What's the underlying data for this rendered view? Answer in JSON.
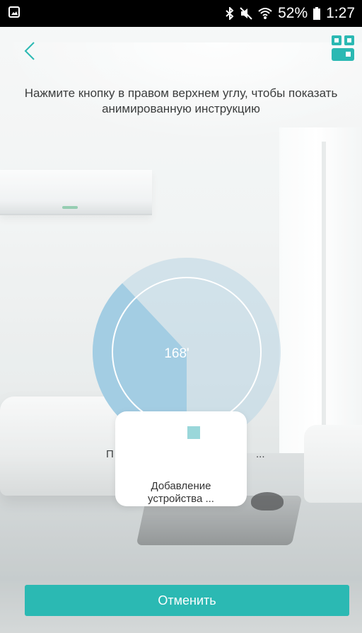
{
  "status_bar": {
    "battery": "52%",
    "time": "1:27"
  },
  "header": {
    "back_icon": "chevron-left-icon",
    "scan_icon": "qr-code-icon"
  },
  "instruction": {
    "line1": "Нажмите кнопку в правом верхнем углу, чтобы показать",
    "line2": "анимированную инструкцию"
  },
  "progress": {
    "label": "168'",
    "fraction": 0.38,
    "hint_left": "П",
    "hint_right": "..."
  },
  "loading_dialog": {
    "line1": "Добавление",
    "line2": "устройства ..."
  },
  "actions": {
    "cancel_label": "Отменить"
  },
  "colors": {
    "accent": "#2bb9b3",
    "progress_fill": "#a3cde3",
    "status_bar": "#000000"
  }
}
